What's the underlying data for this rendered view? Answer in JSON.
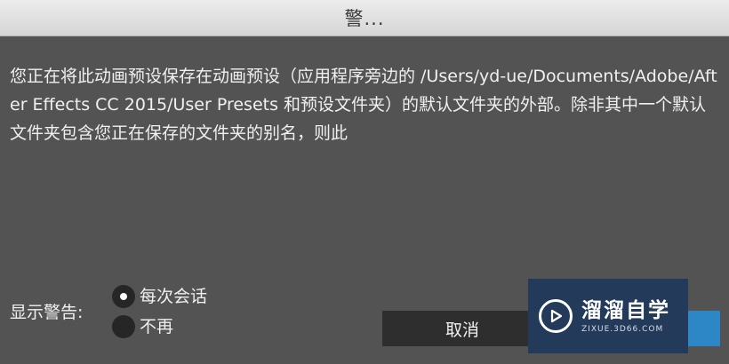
{
  "dialog": {
    "title": "警...",
    "message": "您正在将此动画预设保存在动画预设（应用程序旁边的 /Users/yd-ue/Documents/Adobe/After Effects CC 2015/User Presets 和预设文件夹）的默认文件夹的外部。除非其中一个默认文件夹包含您正在保存的文件夹的别名，则此"
  },
  "warning": {
    "label": "显示警告:",
    "options": [
      {
        "label": "每次会话",
        "selected": true
      },
      {
        "label": "不再",
        "selected": false
      }
    ]
  },
  "buttons": {
    "cancel_label": "取消"
  },
  "watermark": {
    "name": "溜溜自学",
    "url": "ZIXUE.3D66.COM"
  },
  "colors": {
    "background": "#535353",
    "titlebar": "#e0e0e0",
    "primary_button": "#2d86c6",
    "watermark_bg": "#233a5a"
  }
}
